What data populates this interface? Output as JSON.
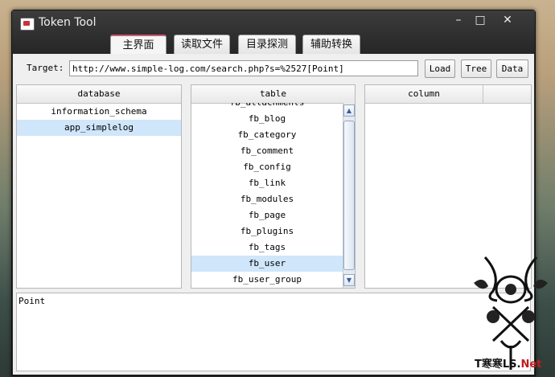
{
  "window": {
    "title": "Token Tool",
    "controls": {
      "minimize": "–",
      "maximize": "□",
      "close": "✕"
    }
  },
  "tabs": [
    {
      "label": "主界面",
      "active": true
    },
    {
      "label": "读取文件",
      "active": false
    },
    {
      "label": "目录探测",
      "active": false
    },
    {
      "label": "辅助转换",
      "active": false
    }
  ],
  "target": {
    "label": "Target:",
    "value": "http://www.simple-log.com/search.php?s=%2527[Point]"
  },
  "buttons": {
    "load": "Load",
    "tree": "Tree",
    "data": "Data"
  },
  "database_panel": {
    "header": "database",
    "items": [
      {
        "label": "information_schema",
        "selected": false
      },
      {
        "label": "app_simplelog",
        "selected": true
      }
    ]
  },
  "table_panel": {
    "header": "table",
    "items": [
      {
        "label": "fb_attachments",
        "selected": false
      },
      {
        "label": "fb_blog",
        "selected": false
      },
      {
        "label": "fb_category",
        "selected": false
      },
      {
        "label": "fb_comment",
        "selected": false
      },
      {
        "label": "fb_config",
        "selected": false
      },
      {
        "label": "fb_link",
        "selected": false
      },
      {
        "label": "fb_modules",
        "selected": false
      },
      {
        "label": "fb_page",
        "selected": false
      },
      {
        "label": "fb_plugins",
        "selected": false
      },
      {
        "label": "fb_tags",
        "selected": false
      },
      {
        "label": "fb_user",
        "selected": true
      },
      {
        "label": "fb_user_group",
        "selected": false
      }
    ]
  },
  "column_panel": {
    "header": "column"
  },
  "output": {
    "text": "Point"
  },
  "watermark": {
    "prefix": "T寒寒LS.",
    "suffix": "Net"
  }
}
